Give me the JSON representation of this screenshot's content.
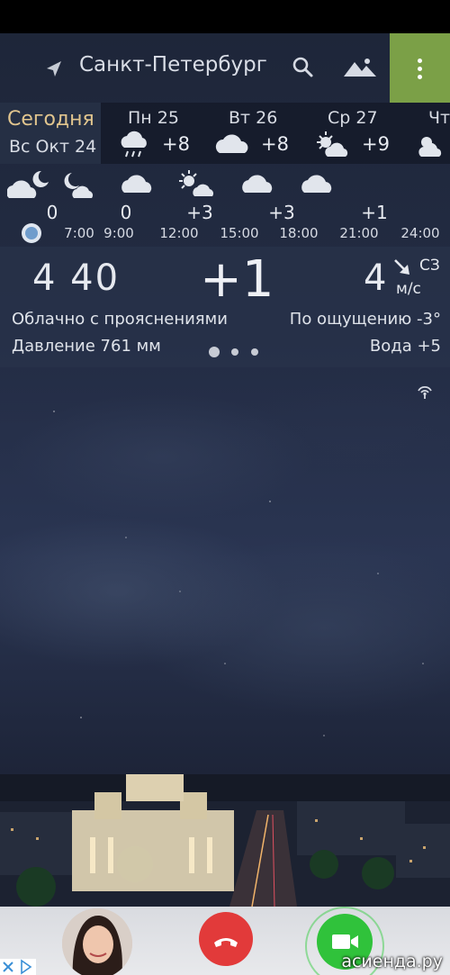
{
  "toolbar": {
    "city": "Санкт-Петербург",
    "icons": {
      "location": "navigation-arrow-icon",
      "search": "search-icon",
      "background": "landscape-icon",
      "menu": "more-vert-icon"
    },
    "menu_color": "#7ba047"
  },
  "days": {
    "today": {
      "label": "Сегодня",
      "date": "Вс Окт 24"
    },
    "items": [
      {
        "name": "Пн 25",
        "temp": "+8",
        "icon": "rain-cloud-icon"
      },
      {
        "name": "Вт 26",
        "temp": "+8",
        "icon": "cloud-icon"
      },
      {
        "name": "Ср 27",
        "temp": "+9",
        "icon": "sun-cloud-icon"
      },
      {
        "name": "Чт",
        "temp": "",
        "icon": "sun-cloud-icon"
      }
    ]
  },
  "hourly": [
    {
      "temp": "0",
      "time": "7:00",
      "icon": "cloud-moon-icon"
    },
    {
      "temp": "0",
      "time": "9:00",
      "icon": "cloud-icon"
    },
    {
      "temp": "+3",
      "time": "12:00",
      "icon": "sun-cloud-icon"
    },
    {
      "temp": "+3",
      "time": "15:00",
      "icon": "cloud-icon"
    },
    {
      "temp": "+1",
      "time": "18:00",
      "icon": "cloud-icon"
    },
    {
      "temp": "",
      "time": "21:00",
      "icon": ""
    },
    {
      "temp": "",
      "time": "24:00",
      "icon": ""
    }
  ],
  "current": {
    "time": "4 40",
    "temp": "+1",
    "wind_speed": "4",
    "wind_dir": "СЗ",
    "wind_unit": "м/с",
    "condition": "Облачно с прояснениями",
    "feels_like": "По ощущению -3°",
    "pressure": "Давление 761 мм",
    "water": "Вода +5"
  },
  "ad": {
    "watermark": "асиенда.ру",
    "accent_decline": "#e23a3a",
    "accent_accept": "#30c23b"
  }
}
